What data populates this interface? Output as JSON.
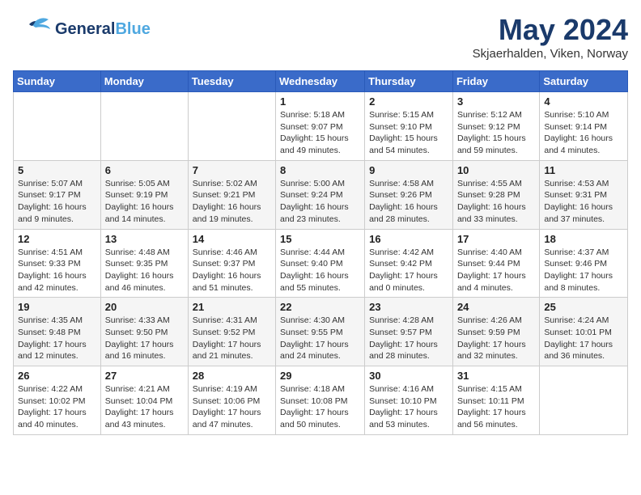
{
  "header": {
    "logo_general": "General",
    "logo_blue": "Blue",
    "month_title": "May 2024",
    "location": "Skjaerhalden, Viken, Norway"
  },
  "weekdays": [
    "Sunday",
    "Monday",
    "Tuesday",
    "Wednesday",
    "Thursday",
    "Friday",
    "Saturday"
  ],
  "weeks": [
    [
      {
        "day": "",
        "info": ""
      },
      {
        "day": "",
        "info": ""
      },
      {
        "day": "",
        "info": ""
      },
      {
        "day": "1",
        "info": "Sunrise: 5:18 AM\nSunset: 9:07 PM\nDaylight: 15 hours\nand 49 minutes."
      },
      {
        "day": "2",
        "info": "Sunrise: 5:15 AM\nSunset: 9:10 PM\nDaylight: 15 hours\nand 54 minutes."
      },
      {
        "day": "3",
        "info": "Sunrise: 5:12 AM\nSunset: 9:12 PM\nDaylight: 15 hours\nand 59 minutes."
      },
      {
        "day": "4",
        "info": "Sunrise: 5:10 AM\nSunset: 9:14 PM\nDaylight: 16 hours\nand 4 minutes."
      }
    ],
    [
      {
        "day": "5",
        "info": "Sunrise: 5:07 AM\nSunset: 9:17 PM\nDaylight: 16 hours\nand 9 minutes."
      },
      {
        "day": "6",
        "info": "Sunrise: 5:05 AM\nSunset: 9:19 PM\nDaylight: 16 hours\nand 14 minutes."
      },
      {
        "day": "7",
        "info": "Sunrise: 5:02 AM\nSunset: 9:21 PM\nDaylight: 16 hours\nand 19 minutes."
      },
      {
        "day": "8",
        "info": "Sunrise: 5:00 AM\nSunset: 9:24 PM\nDaylight: 16 hours\nand 23 minutes."
      },
      {
        "day": "9",
        "info": "Sunrise: 4:58 AM\nSunset: 9:26 PM\nDaylight: 16 hours\nand 28 minutes."
      },
      {
        "day": "10",
        "info": "Sunrise: 4:55 AM\nSunset: 9:28 PM\nDaylight: 16 hours\nand 33 minutes."
      },
      {
        "day": "11",
        "info": "Sunrise: 4:53 AM\nSunset: 9:31 PM\nDaylight: 16 hours\nand 37 minutes."
      }
    ],
    [
      {
        "day": "12",
        "info": "Sunrise: 4:51 AM\nSunset: 9:33 PM\nDaylight: 16 hours\nand 42 minutes."
      },
      {
        "day": "13",
        "info": "Sunrise: 4:48 AM\nSunset: 9:35 PM\nDaylight: 16 hours\nand 46 minutes."
      },
      {
        "day": "14",
        "info": "Sunrise: 4:46 AM\nSunset: 9:37 PM\nDaylight: 16 hours\nand 51 minutes."
      },
      {
        "day": "15",
        "info": "Sunrise: 4:44 AM\nSunset: 9:40 PM\nDaylight: 16 hours\nand 55 minutes."
      },
      {
        "day": "16",
        "info": "Sunrise: 4:42 AM\nSunset: 9:42 PM\nDaylight: 17 hours\nand 0 minutes."
      },
      {
        "day": "17",
        "info": "Sunrise: 4:40 AM\nSunset: 9:44 PM\nDaylight: 17 hours\nand 4 minutes."
      },
      {
        "day": "18",
        "info": "Sunrise: 4:37 AM\nSunset: 9:46 PM\nDaylight: 17 hours\nand 8 minutes."
      }
    ],
    [
      {
        "day": "19",
        "info": "Sunrise: 4:35 AM\nSunset: 9:48 PM\nDaylight: 17 hours\nand 12 minutes."
      },
      {
        "day": "20",
        "info": "Sunrise: 4:33 AM\nSunset: 9:50 PM\nDaylight: 17 hours\nand 16 minutes."
      },
      {
        "day": "21",
        "info": "Sunrise: 4:31 AM\nSunset: 9:52 PM\nDaylight: 17 hours\nand 21 minutes."
      },
      {
        "day": "22",
        "info": "Sunrise: 4:30 AM\nSunset: 9:55 PM\nDaylight: 17 hours\nand 24 minutes."
      },
      {
        "day": "23",
        "info": "Sunrise: 4:28 AM\nSunset: 9:57 PM\nDaylight: 17 hours\nand 28 minutes."
      },
      {
        "day": "24",
        "info": "Sunrise: 4:26 AM\nSunset: 9:59 PM\nDaylight: 17 hours\nand 32 minutes."
      },
      {
        "day": "25",
        "info": "Sunrise: 4:24 AM\nSunset: 10:01 PM\nDaylight: 17 hours\nand 36 minutes."
      }
    ],
    [
      {
        "day": "26",
        "info": "Sunrise: 4:22 AM\nSunset: 10:02 PM\nDaylight: 17 hours\nand 40 minutes."
      },
      {
        "day": "27",
        "info": "Sunrise: 4:21 AM\nSunset: 10:04 PM\nDaylight: 17 hours\nand 43 minutes."
      },
      {
        "day": "28",
        "info": "Sunrise: 4:19 AM\nSunset: 10:06 PM\nDaylight: 17 hours\nand 47 minutes."
      },
      {
        "day": "29",
        "info": "Sunrise: 4:18 AM\nSunset: 10:08 PM\nDaylight: 17 hours\nand 50 minutes."
      },
      {
        "day": "30",
        "info": "Sunrise: 4:16 AM\nSunset: 10:10 PM\nDaylight: 17 hours\nand 53 minutes."
      },
      {
        "day": "31",
        "info": "Sunrise: 4:15 AM\nSunset: 10:11 PM\nDaylight: 17 hours\nand 56 minutes."
      },
      {
        "day": "",
        "info": ""
      }
    ]
  ]
}
